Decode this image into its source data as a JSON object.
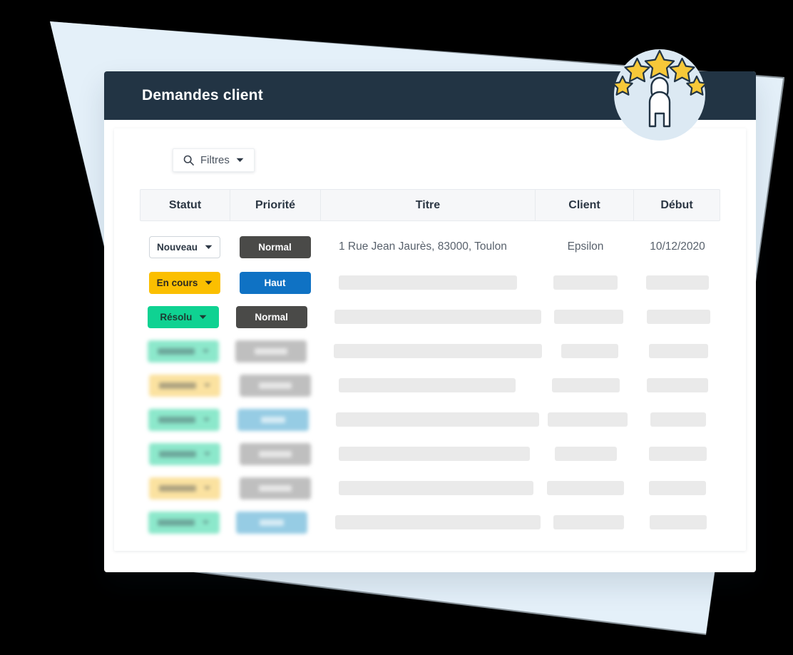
{
  "window": {
    "title": "Demandes client"
  },
  "toolbar": {
    "filters_label": "Filtres",
    "search_icon": "search-icon",
    "caret_icon": "chevron-down-icon"
  },
  "medallion": {
    "icon": "award-person-stars-icon",
    "star_count": 5,
    "star_color": "#f7c839",
    "disc_color": "#dce9f3"
  },
  "colors": {
    "title_bar": "#223444",
    "accent_blue": "#0f72c4",
    "status_new_border": "#cfd5da",
    "status_inprogress": "#fbbf00",
    "status_resolved": "#0fd292",
    "priority_normal": "#4a4a48",
    "priority_high": "#0f72c4",
    "skeleton_gray": "#eaeaea",
    "page_background": "#000000",
    "sheet_blue": "#e4f0f9"
  },
  "table": {
    "columns": [
      {
        "key": "statut",
        "label": "Statut"
      },
      {
        "key": "priorite",
        "label": "Priorité"
      },
      {
        "key": "titre",
        "label": "Titre"
      },
      {
        "key": "client",
        "label": "Client"
      },
      {
        "key": "debut",
        "label": "Début"
      }
    ],
    "rows": [
      {
        "visible": true,
        "statut": {
          "label": "Nouveau",
          "style": "outline",
          "has_caret": true
        },
        "priorite": {
          "label": "Normal",
          "style": "normal"
        },
        "titre": "1 Rue Jean Jaurès, 83000, Toulon",
        "client": "Epsilon",
        "debut": "10/12/2020"
      },
      {
        "visible": true,
        "statut": {
          "label": "En cours",
          "style": "inprogress",
          "has_caret": true
        },
        "priorite": {
          "label": "Haut",
          "style": "high"
        },
        "titre": "",
        "client": "",
        "debut": ""
      },
      {
        "visible": true,
        "statut": {
          "label": "Résolu",
          "style": "resolved",
          "has_caret": true
        },
        "priorite": {
          "label": "Normal",
          "style": "normal"
        },
        "titre": "",
        "client": "",
        "debut": ""
      },
      {
        "visible": false,
        "statut": {
          "style": "resolved"
        },
        "priorite": {
          "style": "normal"
        }
      },
      {
        "visible": false,
        "statut": {
          "style": "inprogress"
        },
        "priorite": {
          "style": "normal"
        }
      },
      {
        "visible": false,
        "statut": {
          "style": "resolved"
        },
        "priorite": {
          "style": "high"
        }
      },
      {
        "visible": false,
        "statut": {
          "style": "resolved"
        },
        "priorite": {
          "style": "normal"
        }
      },
      {
        "visible": false,
        "statut": {
          "style": "inprogress"
        },
        "priorite": {
          "style": "normal"
        }
      },
      {
        "visible": false,
        "statut": {
          "style": "resolved"
        },
        "priorite": {
          "style": "high"
        }
      }
    ],
    "skeleton_widths": {
      "titre": [
        265,
        250,
        290,
        292,
        248,
        285,
        268,
        273,
        288
      ],
      "client": [
        90,
        90,
        97,
        80,
        95,
        112,
        87,
        108,
        99
      ],
      "debut": [
        88,
        88,
        89,
        83,
        86,
        78,
        81,
        80,
        80
      ]
    }
  }
}
